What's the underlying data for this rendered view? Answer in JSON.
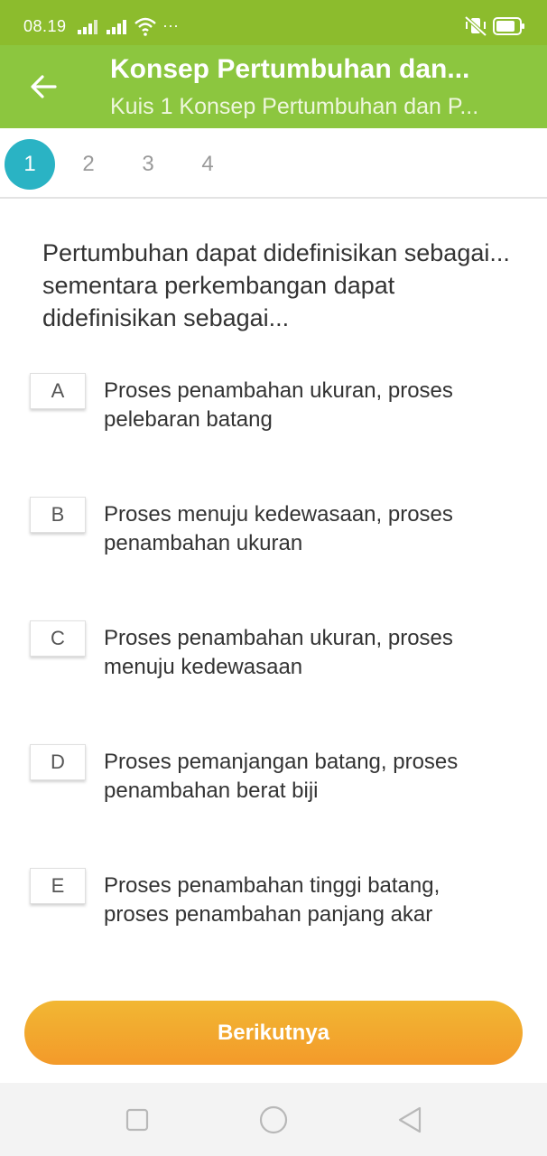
{
  "status_bar": {
    "time": "08.19",
    "more": "···"
  },
  "header": {
    "title": "Konsep Pertumbuhan dan...",
    "subtitle": "Kuis 1 Konsep Pertumbuhan dan P..."
  },
  "steps": [
    {
      "label": "1",
      "active": true
    },
    {
      "label": "2",
      "active": false
    },
    {
      "label": "3",
      "active": false
    },
    {
      "label": "4",
      "active": false
    }
  ],
  "question": "Pertumbuhan dapat didefinisikan sebagai... sementara perkembangan dapat didefinisikan sebagai...",
  "options": [
    {
      "letter": "A",
      "text": "Proses penambahan ukuran, proses pelebaran batang"
    },
    {
      "letter": "B",
      "text": "Proses menuju kedewasaan, proses penambahan ukuran"
    },
    {
      "letter": "C",
      "text": "Proses penambahan ukuran, proses menuju kedewasaan"
    },
    {
      "letter": "D",
      "text": "Proses pemanjangan batang, proses penambahan berat biji"
    },
    {
      "letter": "E",
      "text": "Proses penambahan tinggi batang, proses penambahan panjang akar"
    }
  ],
  "next_button": {
    "label": "Berikutnya"
  },
  "colors": {
    "header": "#8cc63f",
    "active_step": "#2ab3c4",
    "next_button": "#f2a22d"
  }
}
